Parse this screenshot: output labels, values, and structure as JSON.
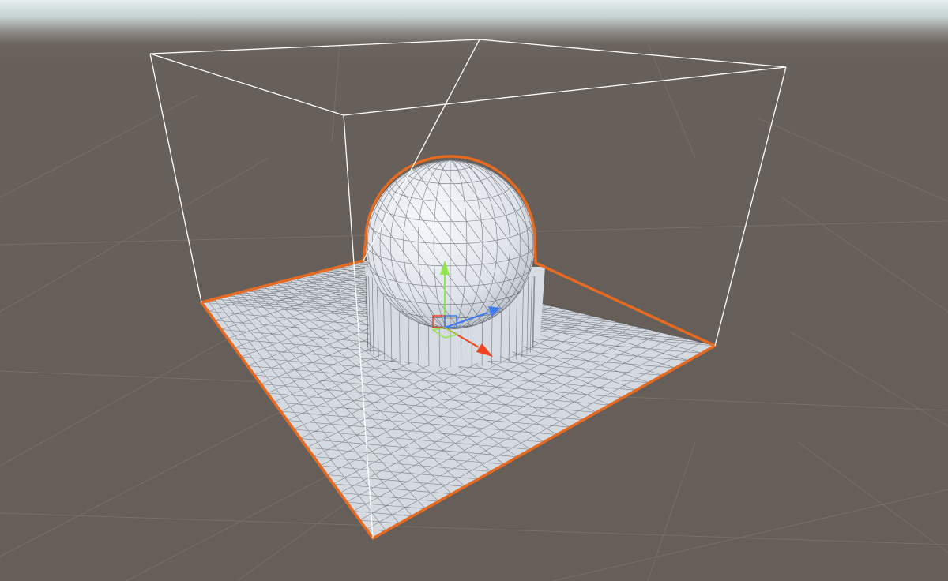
{
  "viewport": {
    "name": "Scene view",
    "background_color": "#675f59",
    "sky_color": "#e4eeee"
  },
  "scene": {
    "objects": [
      {
        "name": "terrain",
        "type": "plane",
        "render_mode": "shaded-wireframe",
        "selected": true
      },
      {
        "name": "sphere",
        "type": "sphere",
        "render_mode": "shaded-wireframe",
        "selected": true
      }
    ],
    "bounds_box": {
      "visible": true,
      "color": "#ffffff"
    }
  },
  "gizmo": {
    "axes": [
      {
        "axis": "y",
        "color": "#8ee64a",
        "icon": "arrow-up-icon"
      },
      {
        "axis": "x",
        "color": "#f0441e",
        "icon": "arrow-right-icon"
      },
      {
        "axis": "z",
        "color": "#3f7bf0",
        "icon": "arrow-forward-icon"
      }
    ]
  },
  "colors": {
    "selection_outline": "#e56a22",
    "mesh_fill": "#d5d9e0",
    "mesh_wire": "#2b2f35",
    "grid_line": "#7b746e"
  }
}
